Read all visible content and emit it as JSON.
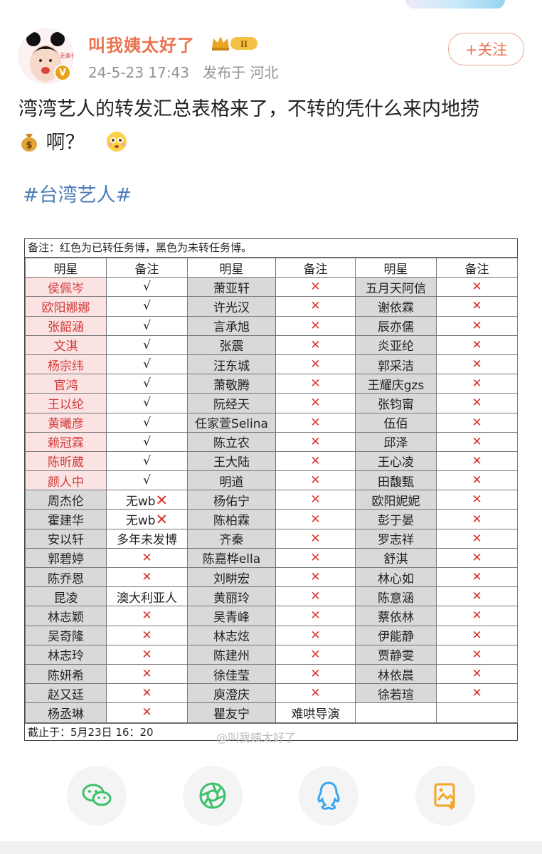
{
  "post": {
    "username": "叫我姨太好了",
    "level_badge": "II",
    "timestamp": "24-5-23 17:43",
    "location": "发布于 河北",
    "follow_label": "+关注",
    "text_line1": "湾湾艺人的转发汇总表格来了，不转的凭什么来内地捞",
    "text_line2": "啊？",
    "topic": "#台湾艺人#",
    "verified_mark": "V"
  },
  "table": {
    "note": "备注：红色为已转任务博，黑色为未转任务博。",
    "headers": [
      "明星",
      "备注",
      "明星",
      "备注",
      "明星",
      "备注"
    ],
    "footer": "截止于：5月23日 16：20",
    "rows": [
      [
        {
          "t": "侯佩岑",
          "c": "pink"
        },
        {
          "t": "√"
        },
        {
          "t": "萧亚轩",
          "c": "grey"
        },
        {
          "x": true
        },
        {
          "t": "五月天阿信",
          "c": "grey"
        },
        {
          "x": true
        }
      ],
      [
        {
          "t": "欧阳娜娜",
          "c": "pink"
        },
        {
          "t": "√"
        },
        {
          "t": "许光汉",
          "c": "grey"
        },
        {
          "x": true
        },
        {
          "t": "谢依霖",
          "c": "grey"
        },
        {
          "x": true
        }
      ],
      [
        {
          "t": "张韶涵",
          "c": "pink"
        },
        {
          "t": "√"
        },
        {
          "t": "言承旭",
          "c": "grey"
        },
        {
          "x": true
        },
        {
          "t": "辰亦儒",
          "c": "grey"
        },
        {
          "x": true
        }
      ],
      [
        {
          "t": "文淇",
          "c": "pink"
        },
        {
          "t": "√"
        },
        {
          "t": "张震",
          "c": "grey"
        },
        {
          "x": true
        },
        {
          "t": "炎亚纶",
          "c": "grey"
        },
        {
          "x": true
        }
      ],
      [
        {
          "t": "杨宗纬",
          "c": "pink"
        },
        {
          "t": "√"
        },
        {
          "t": "汪东城",
          "c": "grey"
        },
        {
          "x": true
        },
        {
          "t": "郭采洁",
          "c": "grey"
        },
        {
          "x": true
        }
      ],
      [
        {
          "t": "官鸿",
          "c": "pink"
        },
        {
          "t": "√"
        },
        {
          "t": "萧敬腾",
          "c": "grey"
        },
        {
          "x": true
        },
        {
          "t": "王耀庆gzs",
          "c": "grey"
        },
        {
          "x": true
        }
      ],
      [
        {
          "t": "王以纶",
          "c": "pink"
        },
        {
          "t": "√"
        },
        {
          "t": "阮经天",
          "c": "grey"
        },
        {
          "x": true
        },
        {
          "t": "张钧甯",
          "c": "grey"
        },
        {
          "x": true
        }
      ],
      [
        {
          "t": "黄曦彦",
          "c": "pink"
        },
        {
          "t": "√"
        },
        {
          "t": "任家萱Selina",
          "c": "grey"
        },
        {
          "x": true
        },
        {
          "t": "伍佰",
          "c": "grey"
        },
        {
          "x": true
        }
      ],
      [
        {
          "t": "赖冠霖",
          "c": "pink"
        },
        {
          "t": "√"
        },
        {
          "t": "陈立农",
          "c": "grey"
        },
        {
          "x": true
        },
        {
          "t": "邱泽",
          "c": "grey"
        },
        {
          "x": true
        }
      ],
      [
        {
          "t": "陈昕葳",
          "c": "pink"
        },
        {
          "t": "√"
        },
        {
          "t": "王大陆",
          "c": "grey"
        },
        {
          "x": true
        },
        {
          "t": "王心凌",
          "c": "grey"
        },
        {
          "x": true
        }
      ],
      [
        {
          "t": "颜人中",
          "c": "pink"
        },
        {
          "t": "√"
        },
        {
          "t": "明道",
          "c": "grey"
        },
        {
          "x": true
        },
        {
          "t": "田馥甄",
          "c": "grey"
        },
        {
          "x": true
        }
      ],
      [
        {
          "t": "周杰伦",
          "c": "grey"
        },
        {
          "t": "无wb",
          "x2": true
        },
        {
          "t": "杨佑宁",
          "c": "grey"
        },
        {
          "x": true
        },
        {
          "t": "欧阳妮妮",
          "c": "grey"
        },
        {
          "x": true
        }
      ],
      [
        {
          "t": "霍建华",
          "c": "grey"
        },
        {
          "t": "无wb",
          "x2": true
        },
        {
          "t": "陈柏霖",
          "c": "grey"
        },
        {
          "x": true
        },
        {
          "t": "彭于晏",
          "c": "grey"
        },
        {
          "x": true
        }
      ],
      [
        {
          "t": "安以轩",
          "c": "grey"
        },
        {
          "t": "多年未发博"
        },
        {
          "t": "齐秦",
          "c": "grey"
        },
        {
          "x": true
        },
        {
          "t": "罗志祥",
          "c": "grey"
        },
        {
          "x": true
        }
      ],
      [
        {
          "t": "郭碧婷",
          "c": "grey"
        },
        {
          "x": true
        },
        {
          "t": "陈嘉桦ella",
          "c": "grey"
        },
        {
          "x": true
        },
        {
          "t": "舒淇",
          "c": "grey"
        },
        {
          "x": true
        }
      ],
      [
        {
          "t": "陈乔恩",
          "c": "grey"
        },
        {
          "x": true
        },
        {
          "t": "刘畊宏",
          "c": "grey"
        },
        {
          "x": true
        },
        {
          "t": "林心如",
          "c": "grey"
        },
        {
          "x": true
        }
      ],
      [
        {
          "t": "昆凌",
          "c": "grey"
        },
        {
          "t": "澳大利亚人"
        },
        {
          "t": "黄丽玲",
          "c": "grey"
        },
        {
          "x": true
        },
        {
          "t": "陈意涵",
          "c": "grey"
        },
        {
          "x": true
        }
      ],
      [
        {
          "t": "林志颖",
          "c": "grey"
        },
        {
          "x": true
        },
        {
          "t": "吴青峰",
          "c": "grey"
        },
        {
          "x": true
        },
        {
          "t": "蔡依林",
          "c": "grey"
        },
        {
          "x": true
        }
      ],
      [
        {
          "t": "吴奇隆",
          "c": "grey"
        },
        {
          "x": true
        },
        {
          "t": "林志炫",
          "c": "grey"
        },
        {
          "x": true
        },
        {
          "t": "伊能静",
          "c": "grey"
        },
        {
          "x": true
        }
      ],
      [
        {
          "t": "林志玲",
          "c": "grey"
        },
        {
          "x": true
        },
        {
          "t": "陈建州",
          "c": "grey"
        },
        {
          "x": true
        },
        {
          "t": "贾静雯",
          "c": "grey"
        },
        {
          "x": true
        }
      ],
      [
        {
          "t": "陈妍希",
          "c": "grey"
        },
        {
          "x": true
        },
        {
          "t": "徐佳莹",
          "c": "grey"
        },
        {
          "x": true
        },
        {
          "t": "林依晨",
          "c": "grey"
        },
        {
          "x": true
        }
      ],
      [
        {
          "t": "赵又廷",
          "c": "grey"
        },
        {
          "x": true
        },
        {
          "t": "庾澄庆",
          "c": "grey"
        },
        {
          "x": true
        },
        {
          "t": "徐若瑄",
          "c": "grey"
        },
        {
          "x": true
        }
      ],
      [
        {
          "t": "杨丞琳",
          "c": "grey"
        },
        {
          "x": true
        },
        {
          "t": "瞿友宁",
          "c": "grey"
        },
        {
          "t": "难哄导演"
        },
        {
          "t": ""
        },
        {
          "t": ""
        }
      ]
    ]
  },
  "watermark": "@叫我姨太好了",
  "actions": [
    {
      "name": "wechat-share-button",
      "icon": "wechat-icon",
      "color": "#3ec16d"
    },
    {
      "name": "moments-share-button",
      "icon": "moments-icon",
      "color": "#3ec16d"
    },
    {
      "name": "qq-share-button",
      "icon": "qq-icon",
      "color": "#3aa5ef"
    },
    {
      "name": "save-image-button",
      "icon": "save-image-icon",
      "color": "#f4a523"
    }
  ],
  "colors": {
    "accent": "#eb7350",
    "topic": "#4a7cb8",
    "cross": "#d8342f",
    "pink_cell": "#fbe3e3",
    "grey_cell": "#d9d9d9"
  }
}
